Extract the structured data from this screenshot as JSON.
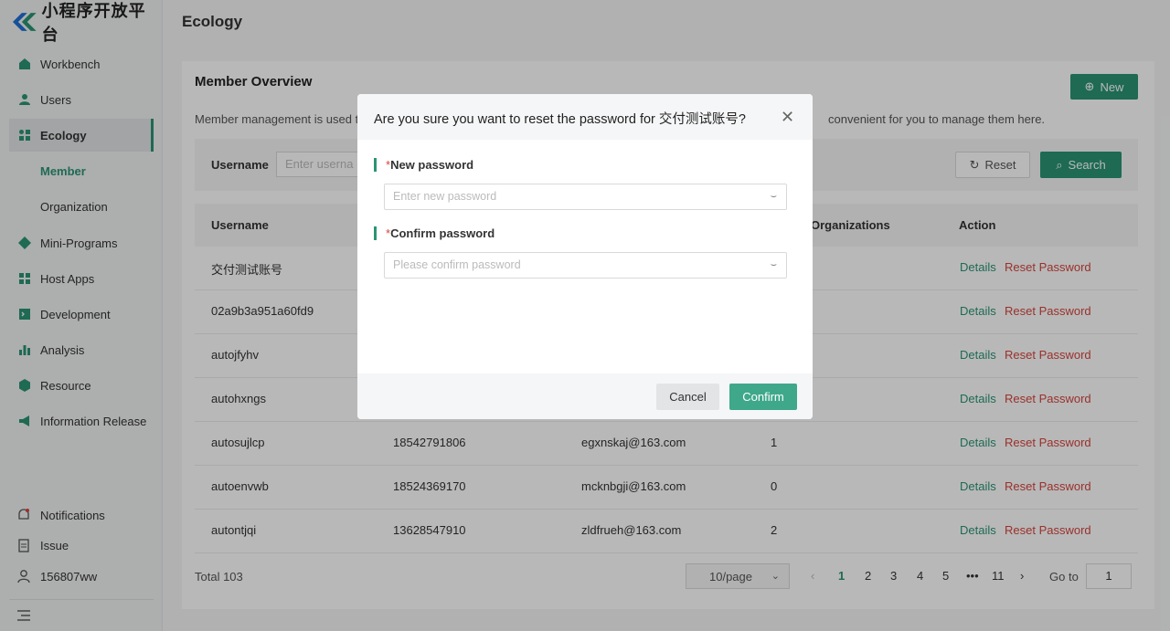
{
  "app": {
    "logo_text": "小程序开放平台",
    "page_title": "Ecology"
  },
  "sidebar": {
    "items": [
      {
        "label": "Workbench",
        "icon": "home-icon"
      },
      {
        "label": "Users",
        "icon": "user-icon"
      },
      {
        "label": "Ecology",
        "icon": "grid-icon",
        "active": true
      },
      {
        "label": "Mini-Programs",
        "icon": "diamond-icon"
      },
      {
        "label": "Host Apps",
        "icon": "apps-icon"
      },
      {
        "label": "Development",
        "icon": "terminal-icon"
      },
      {
        "label": "Analysis",
        "icon": "bar-chart-icon"
      },
      {
        "label": "Resource",
        "icon": "cube-icon"
      },
      {
        "label": "Information Release",
        "icon": "megaphone-icon"
      }
    ],
    "sub_items": [
      {
        "label": "Member",
        "active": true
      },
      {
        "label": "Organization"
      }
    ],
    "bottom": {
      "notifications": "Notifications",
      "issue": "Issue",
      "user": "156807ww"
    }
  },
  "card": {
    "title": "Member Overview",
    "new_label": "New",
    "desc_left": "Member management is used t",
    "desc_right": "convenient for you to manage them here.",
    "filter": {
      "label": "Username",
      "placeholder": "Enter userna",
      "reset_label": "Reset",
      "search_label": "Search"
    },
    "columns": [
      "Username",
      "Organizations",
      "Action"
    ],
    "rows": [
      {
        "username": "交付测试账号",
        "phone": "",
        "email": "",
        "orgs": ""
      },
      {
        "username": "02a9b3a951a60fd9",
        "phone": "",
        "email": "",
        "orgs": ""
      },
      {
        "username": "autojfyhv",
        "phone": "",
        "email": "",
        "orgs": ""
      },
      {
        "username": "autohxngs",
        "phone": "",
        "email": "",
        "orgs": ""
      },
      {
        "username": "autosujlcp",
        "phone": "18542791806",
        "email": "egxnskaj@163.com",
        "orgs": "1"
      },
      {
        "username": "autoenvwb",
        "phone": "18524369170",
        "email": "mcknbgji@163.com",
        "orgs": "0"
      },
      {
        "username": "autontjqi",
        "phone": "13628547910",
        "email": "zldfrueh@163.com",
        "orgs": "2"
      }
    ],
    "action_details": "Details",
    "action_reset": "Reset Password",
    "pagination": {
      "total": "Total 103",
      "page_size": "10/page",
      "pages": [
        "1",
        "2",
        "3",
        "4",
        "5",
        "•••",
        "11"
      ],
      "goto_label": "Go to",
      "goto_value": "1"
    }
  },
  "modal": {
    "title": "Are you sure you want to reset the password for 交付测试账号?",
    "new_password_label": "New password",
    "new_password_placeholder": "Enter new password",
    "confirm_password_label": "Confirm password",
    "confirm_password_placeholder": "Please confirm password",
    "required_mark": "*",
    "cancel_label": "Cancel",
    "confirm_label": "Confirm"
  },
  "colors": {
    "accent": "#2a9474",
    "danger": "#d6453d",
    "confirm": "#3fa88a"
  }
}
